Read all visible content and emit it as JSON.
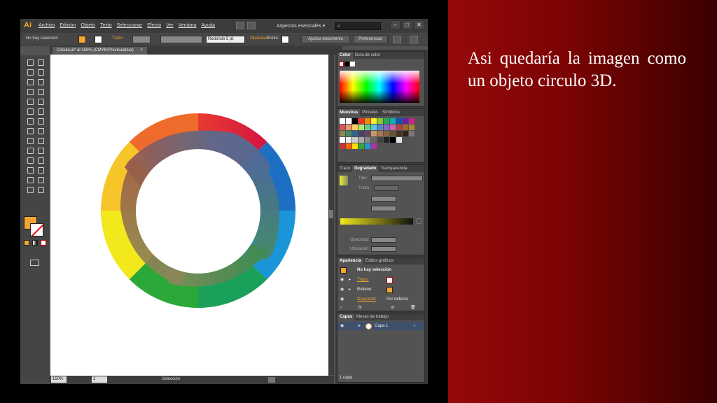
{
  "caption": "Asi quedaría la imagen como un objeto circulo 3D.",
  "app": {
    "logo": "Ai",
    "menu": [
      "Archivo",
      "Edición",
      "Objeto",
      "Texto",
      "Seleccionar",
      "Efecto",
      "Ver",
      "Ventana",
      "Ayuda"
    ],
    "workspace": "Aspectos esenciales",
    "window_buttons": [
      "–",
      "□",
      "✕"
    ],
    "colors": {
      "fill": "#f7a531",
      "ui_dark": "#3c3c3c",
      "ui_mid": "#535353"
    }
  },
  "controlbar": {
    "selection": "No hay selección",
    "trazo_label": "Trazo:",
    "brush": "Redondo 5 pt.",
    "opacidad_label": "Opacidad",
    "estilo_label": "Estilo:",
    "ajustar_btn": "Ajustar documento",
    "preferencias_btn": "Preferencias"
  },
  "document": {
    "tab_title": "Circulo.ai* al 150% (CMYK/Previsualizar)",
    "tab_close": "×",
    "zoom": "150%",
    "page": "1",
    "status": "Selección"
  },
  "panels": {
    "color_tabs": [
      "Color",
      "Guía de color"
    ],
    "swatch_tabs": [
      "Muestras",
      "Pinceles",
      "Símbolos"
    ],
    "gradient_tabs": [
      "Trazo",
      "Degradado",
      "Transparencia"
    ],
    "gradient_tipo": "Tipo:",
    "gradient_trazo": "Trazo:",
    "gradient_opacidad": "Opacidad:",
    "gradient_ubicacion": "Ubicación:",
    "appearance_tabs": [
      "Apariencia",
      "Estilos gráficos"
    ],
    "appearance_header": "No hay selección",
    "appearance_rows": [
      {
        "label": "Trazo:",
        "value": ""
      },
      {
        "label": "Relleno:",
        "value": ""
      },
      {
        "label": "Opacidad:",
        "value": "Por defecto"
      }
    ],
    "appearance_fx": "fx",
    "layers_tabs": [
      "Capas",
      "Mesas de trabajo"
    ],
    "layer_name": "Capa 1",
    "layers_count": "1 capa"
  }
}
